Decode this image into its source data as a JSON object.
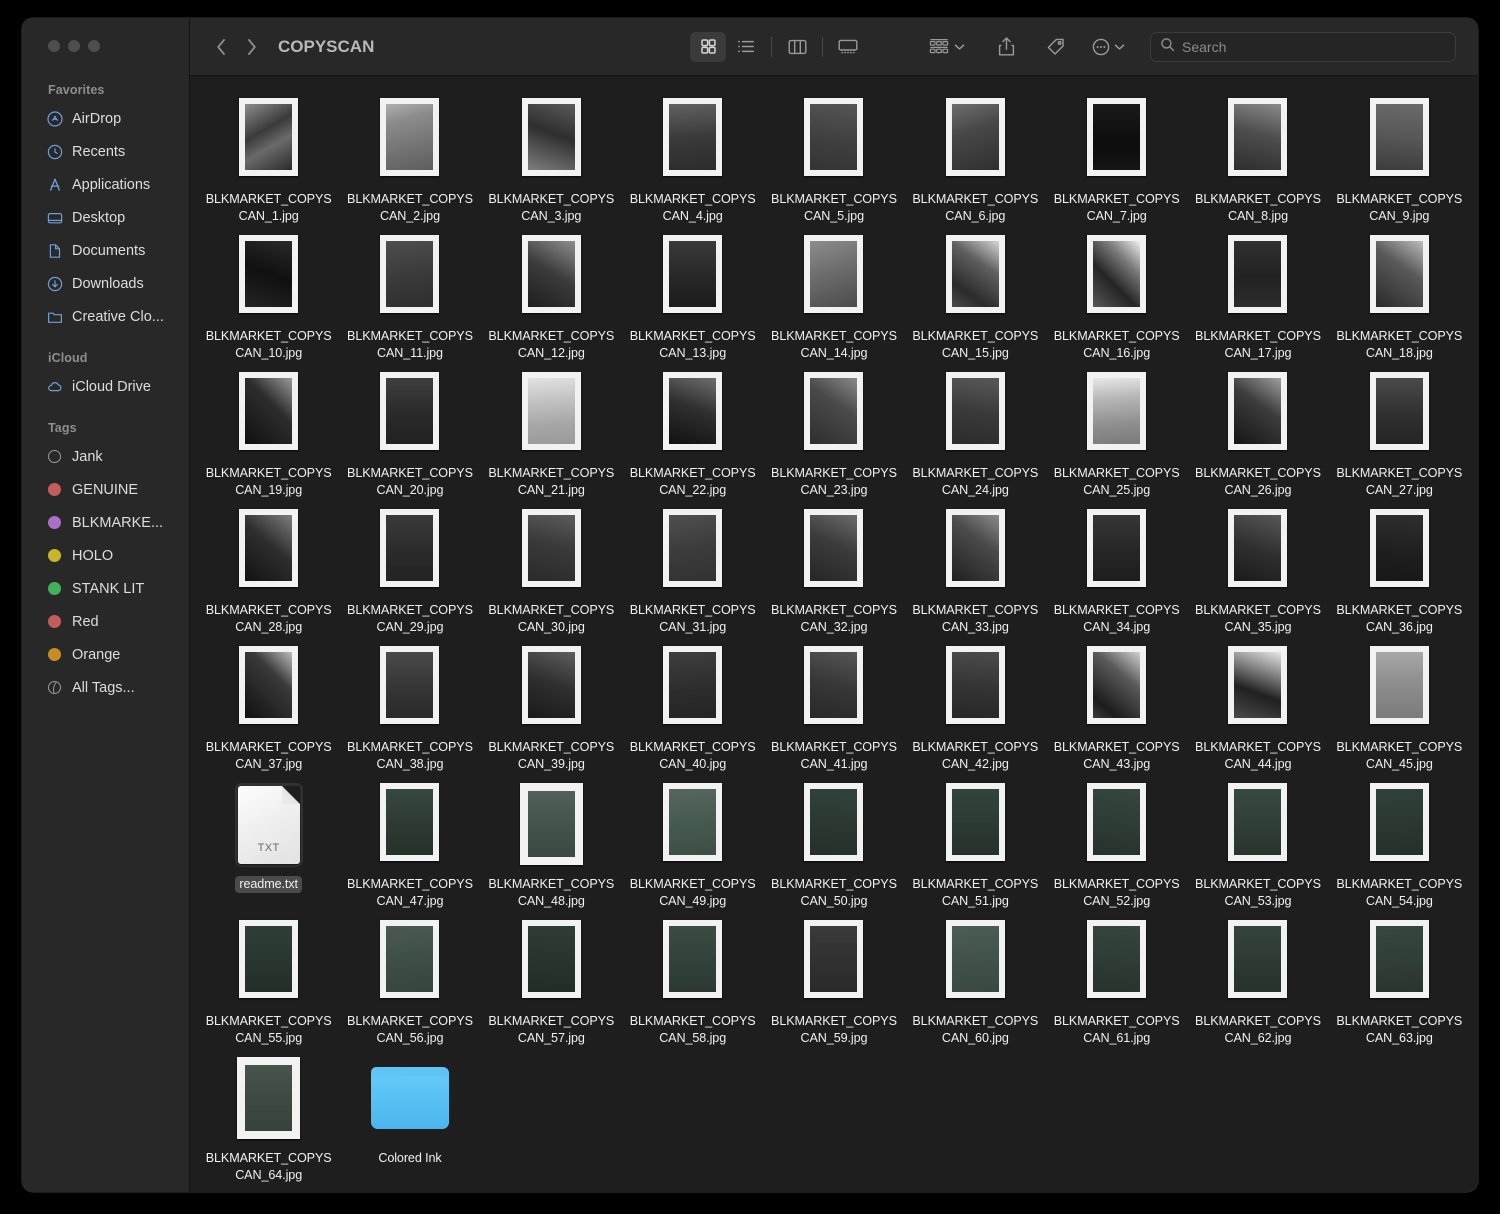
{
  "window": {
    "traffic_lights": [
      "close",
      "minimize",
      "zoom"
    ]
  },
  "toolbar": {
    "back_label": "‹",
    "forward_label": "›",
    "path_title": "COPYSCAN",
    "view_icon_label": "icon-view",
    "view_list_label": "list-view",
    "view_column_label": "column-view",
    "view_gallery_label": "gallery-view",
    "group_label": "group-by",
    "share_label": "share",
    "tags_label": "tags",
    "more_label": "more-actions"
  },
  "search": {
    "placeholder": "Search",
    "value": ""
  },
  "sidebar": {
    "sections": [
      {
        "title": "Favorites",
        "items": [
          {
            "label": "AirDrop",
            "icon": "airdrop-icon"
          },
          {
            "label": "Recents",
            "icon": "clock-icon"
          },
          {
            "label": "Applications",
            "icon": "applications-icon"
          },
          {
            "label": "Desktop",
            "icon": "desktop-icon"
          },
          {
            "label": "Documents",
            "icon": "document-icon"
          },
          {
            "label": "Downloads",
            "icon": "downloads-icon"
          },
          {
            "label": "Creative Clo...",
            "icon": "folder-icon"
          }
        ]
      },
      {
        "title": "iCloud",
        "items": [
          {
            "label": "iCloud Drive",
            "icon": "cloud-icon"
          }
        ]
      },
      {
        "title": "Tags",
        "items": [
          {
            "label": "Jank",
            "color": "none"
          },
          {
            "label": "GENUINE",
            "color": "#c45c5c"
          },
          {
            "label": "BLKMARKE...",
            "color": "#a濃"
          },
          {
            "label": "HOLO",
            "color": "#c7b62b"
          },
          {
            "label": "STANK LIT",
            "color": "#45b05a"
          },
          {
            "label": "Red",
            "color": "#c45c5c"
          },
          {
            "label": "Orange",
            "color": "#c98c25"
          },
          {
            "label": "All Tags...",
            "color": "alltags"
          }
        ]
      }
    ]
  },
  "colors": {
    "window_bg": "#1e1e1e",
    "sidebar_bg": "#282828",
    "toolbar_bg": "#282828",
    "accent_blue": "#6f9fd8",
    "folder_blue": "#4cb8ef",
    "selection": "#4a4a4a"
  },
  "files": [
    {
      "name": "BLKMARKET_COPYSCAN_1.jpg",
      "type": "photo",
      "tone": "linear-gradient(150deg,#8e8e8e 0%,#3a3a3a 40%,#6a6a6a 62%,#2b2b2b 100%)"
    },
    {
      "name": "BLKMARKET_COPYSCAN_2.jpg",
      "type": "photo",
      "tone": "linear-gradient(165deg,#b0b0b0 0%,#8c8c8c 25%,#6f6f6f 70%,#5e5e5e 100%)"
    },
    {
      "name": "BLKMARKET_COPYSCAN_3.jpg",
      "type": "photo",
      "tone": "linear-gradient(200deg,#5a5a5a 0%,#2e2e2e 45%,#7e7e7e 100%)"
    },
    {
      "name": "BLKMARKET_COPYSCAN_4.jpg",
      "type": "photo",
      "tone": "linear-gradient(175deg,#616161 0%,#3a3a3a 50%,#2c2c2c 100%)"
    },
    {
      "name": "BLKMARKET_COPYSCAN_5.jpg",
      "type": "photo",
      "tone": "linear-gradient(190deg,#555555 0%,#3f3f3f 55%,#343434 100%)"
    },
    {
      "name": "BLKMARKET_COPYSCAN_6.jpg",
      "type": "photo",
      "tone": "linear-gradient(160deg,#6e6e6e 0%,#484848 40%,#2f2f2f 100%)"
    },
    {
      "name": "BLKMARKET_COPYSCAN_7.jpg",
      "type": "photo",
      "tone": "linear-gradient(180deg,#1a1a1a 0%,#0d0d0d 60%,#151515 100%)"
    },
    {
      "name": "BLKMARKET_COPYSCAN_8.jpg",
      "type": "photo",
      "tone": "linear-gradient(195deg,#8a8a8a 0%,#4e4e4e 45%,#2d2d2d 100%)"
    },
    {
      "name": "BLKMARKET_COPYSCAN_9.jpg",
      "type": "photo",
      "tone": "linear-gradient(185deg,#6a6a6a 0%,#575757 50%,#3c3c3c 100%)"
    },
    {
      "name": "BLKMARKET_COPYSCAN_10.jpg",
      "type": "photo",
      "tone": "linear-gradient(200deg,#2a2a2a 0%,#101010 50%,#242424 100%)"
    },
    {
      "name": "BLKMARKET_COPYSCAN_11.jpg",
      "type": "photo",
      "tone": "linear-gradient(170deg,#4e4e4e 0%,#3b3b3b 50%,#2e2e2e 100%)"
    },
    {
      "name": "BLKMARKET_COPYSCAN_12.jpg",
      "type": "photo",
      "tone": "linear-gradient(210deg,#8e8e8e 0%,#3b3b3b 48%,#1e1e1e 100%)"
    },
    {
      "name": "BLKMARKET_COPYSCAN_13.jpg",
      "type": "photo",
      "tone": "linear-gradient(180deg,#3a3a3a 0%,#262626 60%,#1b1b1b 100%)"
    },
    {
      "name": "BLKMARKET_COPYSCAN_14.jpg",
      "type": "photo",
      "tone": "linear-gradient(160deg,#8d8d8d 0%,#6d6d6d 45%,#4b4b4b 100%)"
    },
    {
      "name": "BLKMARKET_COPYSCAN_15.jpg",
      "type": "photo",
      "tone": "linear-gradient(215deg,#d6d6d6 0%,#5f5f5f 35%,#2b2b2b 75%,#4a4a4a 100%)"
    },
    {
      "name": "BLKMARKET_COPYSCAN_16.jpg",
      "type": "photo",
      "tone": "linear-gradient(225deg,#f0f0f0 0%,#7a7a7a 30%,#242424 62%,#585858 100%)"
    },
    {
      "name": "BLKMARKET_COPYSCAN_17.jpg",
      "type": "photo",
      "tone": "linear-gradient(180deg,#303030 0%,#222222 55%,#2c2c2c 100%)"
    },
    {
      "name": "BLKMARKET_COPYSCAN_18.jpg",
      "type": "photo",
      "tone": "linear-gradient(215deg,#bcbcbc 0%,#5a5a5a 40%,#2a2a2a 100%)"
    },
    {
      "name": "BLKMARKET_COPYSCAN_19.jpg",
      "type": "photo",
      "tone": "linear-gradient(225deg,#9a9a9a 0%,#2d2d2d 40%,#101010 100%)"
    },
    {
      "name": "BLKMARKET_COPYSCAN_20.jpg",
      "type": "photo",
      "tone": "linear-gradient(180deg,#3e3e3e 0%,#2a2a2a 55%,#212121 100%)"
    },
    {
      "name": "BLKMARKET_COPYSCAN_21.jpg",
      "type": "photo",
      "tone": "linear-gradient(175deg,#e2e2e2 0%,#c2c2c2 35%,#a6a6a6 70%,#9a9a9a 100%)"
    },
    {
      "name": "BLKMARKET_COPYSCAN_22.jpg",
      "type": "photo",
      "tone": "linear-gradient(200deg,#6e6e6e 0%,#303030 45%,#111111 100%)"
    },
    {
      "name": "BLKMARKET_COPYSCAN_23.jpg",
      "type": "photo",
      "tone": "linear-gradient(215deg,#8a8a8a 0%,#4a4a4a 40%,#2e2e2e 100%)"
    },
    {
      "name": "BLKMARKET_COPYSCAN_24.jpg",
      "type": "photo",
      "tone": "linear-gradient(190deg,#595959 0%,#3a3a3a 50%,#2b2b2b 100%)"
    },
    {
      "name": "BLKMARKET_COPYSCAN_25.jpg",
      "type": "photo",
      "tone": "linear-gradient(175deg,#e8e8e8 0%,#b8b8b8 30%,#8e8e8e 70%,#7a7a7a 100%)"
    },
    {
      "name": "BLKMARKET_COPYSCAN_26.jpg",
      "type": "photo",
      "tone": "linear-gradient(215deg,#9e9e9e 0%,#3c3c3c 42%,#151515 100%)"
    },
    {
      "name": "BLKMARKET_COPYSCAN_27.jpg",
      "type": "photo",
      "tone": "linear-gradient(180deg,#4a4a4a 0%,#303030 55%,#242424 100%)"
    },
    {
      "name": "BLKMARKET_COPYSCAN_28.jpg",
      "type": "photo",
      "tone": "linear-gradient(220deg,#7d7d7d 0%,#2e2e2e 45%,#121212 100%)"
    },
    {
      "name": "BLKMARKET_COPYSCAN_29.jpg",
      "type": "photo",
      "tone": "linear-gradient(180deg,#3a3a3a 0%,#2b2b2b 55%,#232323 100%)"
    },
    {
      "name": "BLKMARKET_COPYSCAN_30.jpg",
      "type": "photo",
      "tone": "linear-gradient(195deg,#5c5c5c 0%,#3a3a3a 45%,#2a2a2a 100%)"
    },
    {
      "name": "BLKMARKET_COPYSCAN_31.jpg",
      "type": "photo",
      "tone": "linear-gradient(170deg,#4f4f4f 0%,#3c3c3c 50%,#323232 100%)"
    },
    {
      "name": "BLKMARKET_COPYSCAN_32.jpg",
      "type": "photo",
      "tone": "linear-gradient(205deg,#6b6b6b 0%,#3b3b3b 45%,#262626 100%)"
    },
    {
      "name": "BLKMARKET_COPYSCAN_33.jpg",
      "type": "photo",
      "tone": "linear-gradient(215deg,#8c8c8c 0%,#4b4b4b 38%,#202020 100%)"
    },
    {
      "name": "BLKMARKET_COPYSCAN_34.jpg",
      "type": "photo",
      "tone": "linear-gradient(180deg,#363636 0%,#262626 55%,#1d1d1d 100%)"
    },
    {
      "name": "BLKMARKET_COPYSCAN_35.jpg",
      "type": "photo",
      "tone": "linear-gradient(200deg,#585858 0%,#303030 50%,#1b1b1b 100%)"
    },
    {
      "name": "BLKMARKET_COPYSCAN_36.jpg",
      "type": "photo",
      "tone": "linear-gradient(185deg,#2e2e2e 0%,#1f1f1f 55%,#171717 100%)"
    },
    {
      "name": "BLKMARKET_COPYSCAN_37.jpg",
      "type": "photo",
      "tone": "linear-gradient(225deg,#bdbdbd 0%,#3a3a3a 35%,#101010 100%)"
    },
    {
      "name": "BLKMARKET_COPYSCAN_38.jpg",
      "type": "photo",
      "tone": "linear-gradient(180deg,#4a4a4a 0%,#353535 55%,#2a2a2a 100%)"
    },
    {
      "name": "BLKMARKET_COPYSCAN_39.jpg",
      "type": "photo",
      "tone": "linear-gradient(200deg,#5e5e5e 0%,#2f2f2f 48%,#1a1a1a 100%)"
    },
    {
      "name": "BLKMARKET_COPYSCAN_40.jpg",
      "type": "photo",
      "tone": "linear-gradient(175deg,#3e3e3e 0%,#2d2d2d 55%,#252525 100%)"
    },
    {
      "name": "BLKMARKET_COPYSCAN_41.jpg",
      "type": "photo",
      "tone": "linear-gradient(195deg,#555555 0%,#373737 50%,#282828 100%)"
    },
    {
      "name": "BLKMARKET_COPYSCAN_42.jpg",
      "type": "photo",
      "tone": "linear-gradient(185deg,#4c4c4c 0%,#343434 52%,#272727 100%)"
    },
    {
      "name": "BLKMARKET_COPYSCAN_43.jpg",
      "type": "photo",
      "tone": "linear-gradient(220deg,#d2d2d2 0%,#5a5a5a 35%,#1c1c1c 80%,#3c3c3c 100%)"
    },
    {
      "name": "BLKMARKET_COPYSCAN_44.jpg",
      "type": "photo",
      "tone": "linear-gradient(200deg,#e6e6e6 0%,#8a8a8a 28%,#202020 60%,#4a4a4a 100%)"
    },
    {
      "name": "BLKMARKET_COPYSCAN_45.jpg",
      "type": "photo",
      "tone": "linear-gradient(180deg,#a8a8a8 0%,#8e8e8e 45%,#7c7c7c 100%)"
    },
    {
      "name": "readme.txt",
      "type": "text",
      "tone": "",
      "selected": true,
      "badge": "TXT"
    },
    {
      "name": "BLKMARKET_COPYSCAN_47.jpg",
      "type": "photo",
      "tone": "linear-gradient(180deg,#37483f 0%,#2c3a32 55%,#263229 100%)"
    },
    {
      "name": "BLKMARKET_COPYSCAN_48.jpg",
      "type": "photo-pad",
      "tone": "linear-gradient(180deg,#51615a 0%,#44544c 50%,#3a4a42 100%)"
    },
    {
      "name": "BLKMARKET_COPYSCAN_49.jpg",
      "type": "photo",
      "tone": "linear-gradient(175deg,#56665d 0%,#475a50 50%,#3d4f45 100%)"
    },
    {
      "name": "BLKMARKET_COPYSCAN_50.jpg",
      "type": "photo",
      "tone": "linear-gradient(185deg,#32423a 0%,#2a3830 55%,#243029 100%)"
    },
    {
      "name": "BLKMARKET_COPYSCAN_51.jpg",
      "type": "photo",
      "tone": "linear-gradient(180deg,#33443b 0%,#2b3a32 55%,#25312a 100%)"
    },
    {
      "name": "BLKMARKET_COPYSCAN_52.jpg",
      "type": "photo",
      "tone": "linear-gradient(190deg,#36473e 0%,#2d3c34 55%,#26322b 100%)"
    },
    {
      "name": "BLKMARKET_COPYSCAN_53.jpg",
      "type": "photo",
      "tone": "linear-gradient(180deg,#384a40 0%,#2f3e36 55%,#28352d 100%)"
    },
    {
      "name": "BLKMARKET_COPYSCAN_54.jpg",
      "type": "photo",
      "tone": "linear-gradient(175deg,#31413a 0%,#2a3831 55%,#243029 100%)"
    },
    {
      "name": "BLKMARKET_COPYSCAN_55.jpg",
      "type": "photo",
      "tone": "linear-gradient(180deg,#2f3f37 0%,#283630 55%,#222e27 100%)"
    },
    {
      "name": "BLKMARKET_COPYSCAN_56.jpg",
      "type": "photo",
      "tone": "linear-gradient(175deg,#4a5a52 0%,#3e4f46 50%,#36453d 100%)"
    },
    {
      "name": "BLKMARKET_COPYSCAN_57.jpg",
      "type": "photo",
      "tone": "linear-gradient(185deg,#2e3d35 0%,#27342e 55%,#212c26 100%)"
    },
    {
      "name": "BLKMARKET_COPYSCAN_58.jpg",
      "type": "photo",
      "tone": "linear-gradient(180deg,#3b4c43 0%,#32423a 55%,#2b3932 100%)"
    },
    {
      "name": "BLKMARKET_COPYSCAN_59.jpg",
      "type": "photo",
      "tone": "linear-gradient(180deg,#3a3a3a 0%,#303030 55%,#2a2a2a 100%)"
    },
    {
      "name": "BLKMARKET_COPYSCAN_60.jpg",
      "type": "photo",
      "tone": "linear-gradient(175deg,#4c5d54 0%,#41524a 50%,#394940 100%)"
    },
    {
      "name": "BLKMARKET_COPYSCAN_61.jpg",
      "type": "photo",
      "tone": "linear-gradient(185deg,#35463d 0%,#2d3c34 55%,#27332c 100%)"
    },
    {
      "name": "BLKMARKET_COPYSCAN_62.jpg",
      "type": "photo",
      "tone": "linear-gradient(180deg,#33443b 0%,#2c3a33 55%,#26322b 100%)"
    },
    {
      "name": "BLKMARKET_COPYSCAN_63.jpg",
      "type": "photo",
      "tone": "linear-gradient(175deg,#37483f 0%,#2f3e36 55%,#28352e 100%)"
    },
    {
      "name": "BLKMARKET_COPYSCAN_64.jpg",
      "type": "photo-pad",
      "tone": "linear-gradient(180deg,#47544c 0%,#3d4a42 50%,#36433b 100%)"
    },
    {
      "name": "Colored Ink",
      "type": "folder",
      "tone": ""
    }
  ]
}
